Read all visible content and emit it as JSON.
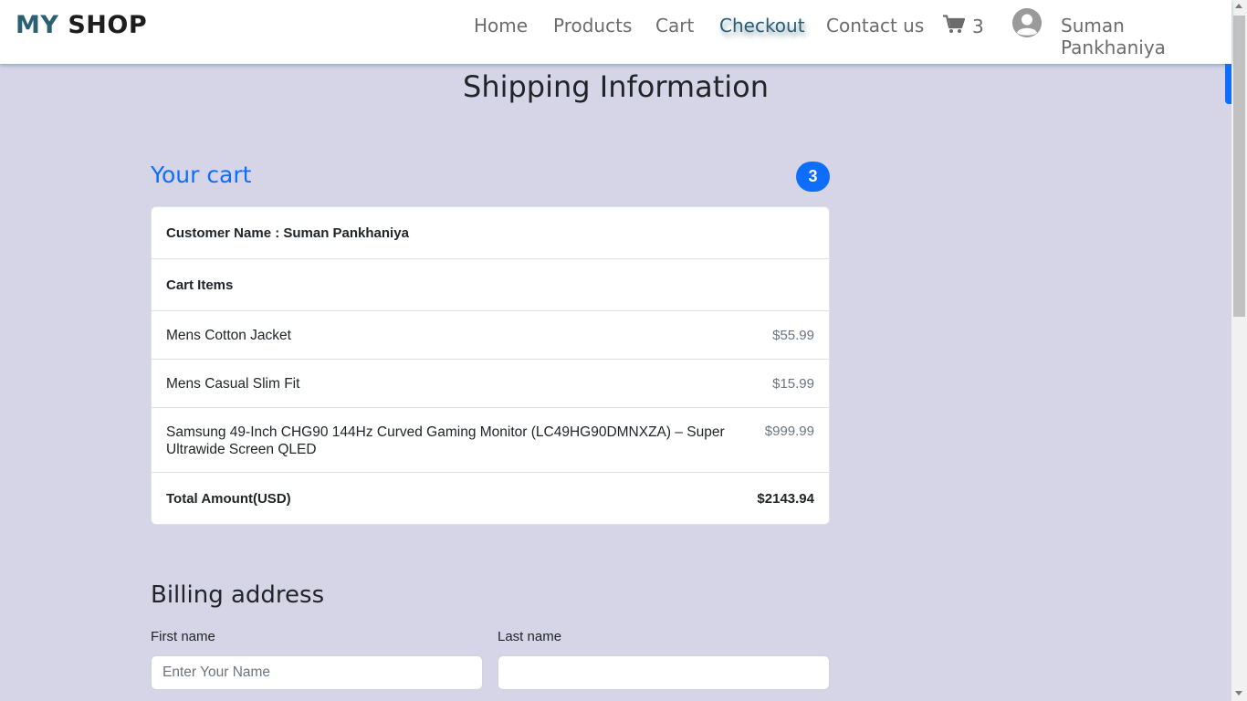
{
  "navbar": {
    "brand_my": "MY",
    "brand_shop": "SHOP",
    "links": [
      "Home",
      "Products",
      "Cart",
      "Checkout",
      "Contact us"
    ],
    "active_link": "Checkout",
    "cart_count": "3",
    "user_name": "Suman Pankhaniya"
  },
  "page": {
    "title": "Shipping Information"
  },
  "cart": {
    "heading": "Your cart",
    "badge": "3",
    "customer_label": "Customer Name : Suman Pankhaniya",
    "items_header": "Cart Items",
    "items": [
      {
        "name": "Mens Cotton Jacket",
        "price": "$55.99"
      },
      {
        "name": "Mens Casual Slim Fit",
        "price": "$15.99"
      },
      {
        "name": "Samsung 49-Inch CHG90 144Hz Curved Gaming Monitor (LC49HG90DMNXZA) – Super Ultrawide Screen QLED",
        "price": "$999.99"
      }
    ],
    "total_label": "Total Amount(USD)",
    "total_value": "$2143.94"
  },
  "billing": {
    "title": "Billing address",
    "first_name_label": "First name",
    "first_name_placeholder": "Enter Your Name",
    "first_name_value": "",
    "last_name_label": "Last name",
    "last_name_value": ""
  },
  "colors": {
    "accent": "#0d6efd",
    "brand": "#2b5f73",
    "background": "#d6d5e7"
  }
}
